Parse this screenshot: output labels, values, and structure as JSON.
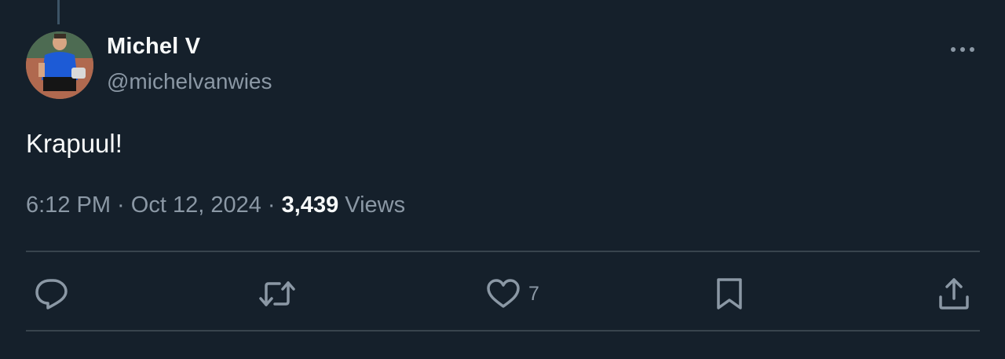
{
  "author": {
    "display_name": "Michel V",
    "handle": "@michelvanwies",
    "avatar_icon": "profile-photo-runner"
  },
  "tweet": {
    "text": "Krapuul!",
    "time": "6:12 PM",
    "separator1": " · ",
    "date": "Oct 12, 2024",
    "separator2": " · ",
    "views_count": "3,439",
    "views_label": " Views"
  },
  "actions": {
    "reply": {
      "icon": "reply-icon",
      "count": ""
    },
    "retweet": {
      "icon": "retweet-icon",
      "count": ""
    },
    "like": {
      "icon": "heart-icon",
      "count": "7"
    },
    "bookmark": {
      "icon": "bookmark-icon",
      "count": ""
    },
    "share": {
      "icon": "share-icon",
      "count": ""
    }
  },
  "colors": {
    "background": "#15202b",
    "primary_text": "#f7f9f9",
    "secondary_text": "#8b98a5",
    "divider": "#38444d"
  }
}
